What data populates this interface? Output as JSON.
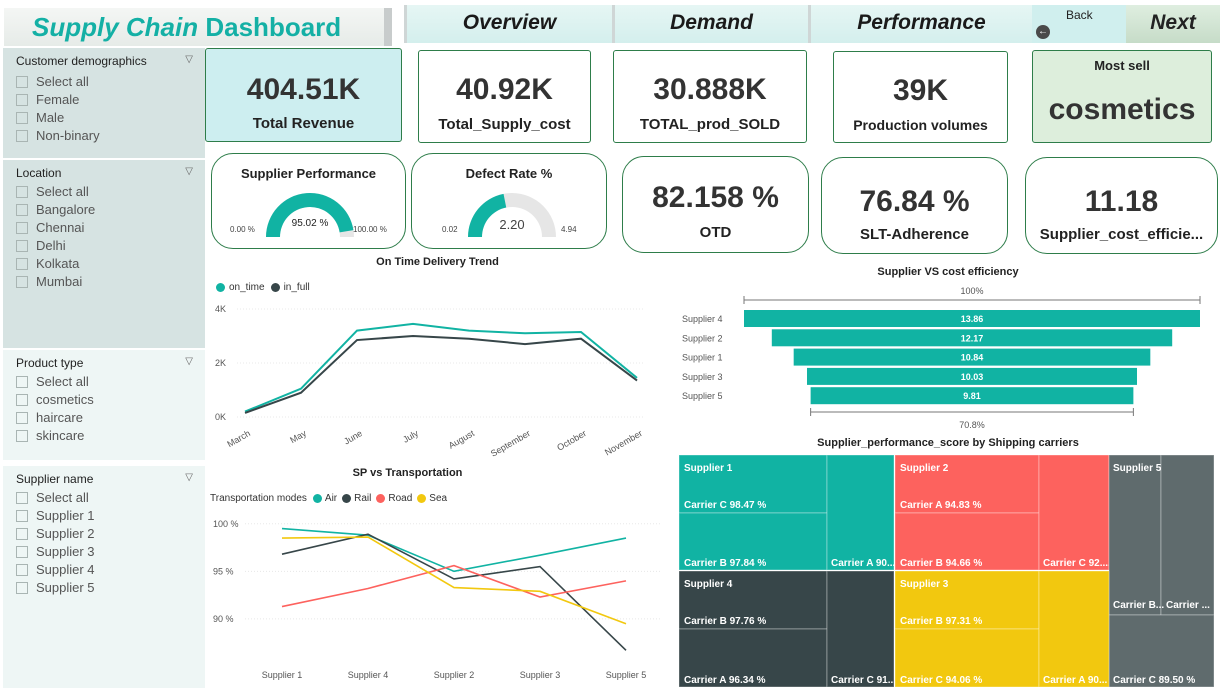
{
  "header": {
    "title_italic": "Supply Chain",
    "title_rest": "Dashboard",
    "tabs": [
      "Overview",
      "Demand",
      "Performance"
    ],
    "back_label": "Back",
    "next_label": "Next"
  },
  "slicers": [
    {
      "title": "Customer demographics",
      "items": [
        "Select all",
        "Female",
        "Male",
        "Non-binary"
      ]
    },
    {
      "title": "Location",
      "items": [
        "Select all",
        "Bangalore",
        "Chennai",
        "Delhi",
        "Kolkata",
        "Mumbai"
      ]
    },
    {
      "title": "Product type",
      "items": [
        "Select all",
        "cosmetics",
        "haircare",
        "skincare"
      ]
    },
    {
      "title": "Supplier name",
      "items": [
        "Select all",
        "Supplier 1",
        "Supplier 2",
        "Supplier 3",
        "Supplier 4",
        "Supplier 5"
      ]
    }
  ],
  "kpis": {
    "revenue": {
      "value": "404.51K",
      "label": "Total Revenue"
    },
    "supply_cost": {
      "value": "40.92K",
      "label": "Total_Supply_cost"
    },
    "prod_sold": {
      "value": "30.888K",
      "label": "TOTAL_prod_SOLD"
    },
    "production": {
      "value": "39K",
      "label": "Production volumes"
    },
    "most_sell": {
      "label": "Most sell",
      "value": "cosmetics"
    },
    "otd": {
      "value": "82.158 %",
      "label": "OTD"
    },
    "slt": {
      "value": "76.84 %",
      "label": "SLT-Adherence"
    },
    "cost_eff": {
      "value": "11.18",
      "label": "Supplier_cost_efficie..."
    }
  },
  "gauges": {
    "supplier_perf": {
      "title": "Supplier Performance",
      "value_label": "95.02 %",
      "min_label": "0.00 %",
      "max_label": "100.00 %",
      "fraction": 0.9502
    },
    "defect": {
      "title": "Defect Rate %",
      "value_label": "2.20",
      "min_label": "0.02",
      "max_label": "4.94",
      "fraction": 0.4384
    }
  },
  "colors": {
    "teal": "#11b3a3",
    "dark": "#374649",
    "red": "#fd625e",
    "yellow": "#f2c80f"
  },
  "chart_data": [
    {
      "type": "line",
      "title": "On Time Delivery Trend",
      "categories": [
        "March",
        "May",
        "June",
        "July",
        "August",
        "September",
        "October",
        "November"
      ],
      "ylim": [
        0,
        4000
      ],
      "yticks": [
        "0K",
        "2K",
        "4K"
      ],
      "legend": "top-left",
      "series": [
        {
          "name": "on_time",
          "values": [
            200,
            1050,
            3200,
            3450,
            3200,
            3100,
            3150,
            1450
          ]
        },
        {
          "name": "in_full",
          "values": [
            150,
            900,
            2850,
            3000,
            2900,
            2700,
            2900,
            1350
          ]
        }
      ]
    },
    {
      "type": "line",
      "title": "SP vs Transportation",
      "legend_title": "Transportation modes",
      "categories": [
        "Supplier 1",
        "Supplier 4",
        "Supplier 2",
        "Supplier 3",
        "Supplier 5"
      ],
      "ylim": [
        86,
        100.5
      ],
      "yticks": [
        "100 %",
        "95 %",
        "90 %"
      ],
      "series": [
        {
          "name": "Air",
          "values": [
            99.5,
            98.8,
            95.0,
            96.7,
            98.5
          ]
        },
        {
          "name": "Rail",
          "values": [
            96.8,
            98.9,
            94.2,
            95.5,
            86.7
          ]
        },
        {
          "name": "Road",
          "values": [
            91.3,
            93.2,
            95.6,
            92.3,
            94.0
          ]
        },
        {
          "name": "Sea",
          "values": [
            98.5,
            98.6,
            93.3,
            92.9,
            89.5
          ]
        }
      ]
    },
    {
      "type": "bar",
      "title": "Supplier VS cost efficiency",
      "top_label": "100%",
      "bottom_label": "70.8%",
      "categories": [
        "Supplier 4",
        "Supplier 2",
        "Supplier 1",
        "Supplier 3",
        "Supplier 5"
      ],
      "values": [
        13.86,
        12.17,
        10.84,
        10.03,
        9.81
      ]
    },
    {
      "type": "heatmap",
      "title": "Supplier_performance_score by Shipping carriers",
      "groups": [
        {
          "name": "Supplier 1",
          "cells": [
            "Carrier C 98.47 %",
            "Carrier B 97.84 %",
            "Carrier A 90..."
          ]
        },
        {
          "name": "Supplier 2",
          "cells": [
            "Carrier A 94.83 %",
            "Carrier B 94.66 %",
            "Carrier C 92...."
          ]
        },
        {
          "name": "Supplier 5",
          "cells": [
            "Carrier B...",
            "Carrier ...",
            "Carrier C 89.50 %"
          ]
        },
        {
          "name": "Supplier 4",
          "cells": [
            "Carrier B 97.76 %",
            "Carrier A 96.34 %",
            "Carrier C 91...."
          ]
        },
        {
          "name": "Supplier 3",
          "cells": [
            "Carrier B 97.31 %",
            "Carrier C 94.06 %",
            "Carrier A 90..."
          ]
        }
      ]
    }
  ]
}
